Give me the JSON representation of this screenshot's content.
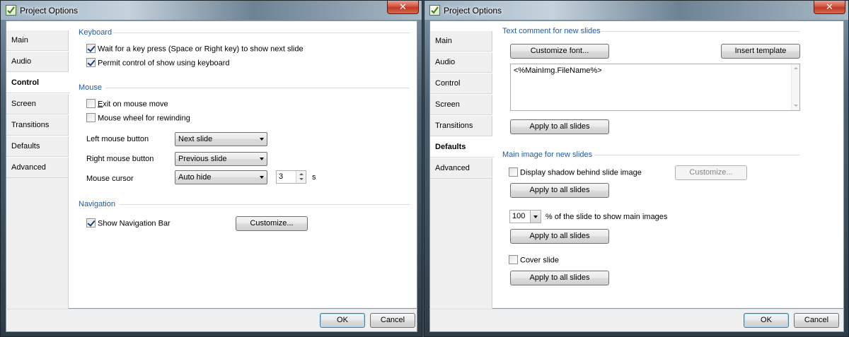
{
  "left": {
    "title": "Project Options",
    "close_glyph": "✕",
    "sidebar": {
      "items": [
        {
          "label": "Main"
        },
        {
          "label": "Audio"
        },
        {
          "label": "Control"
        },
        {
          "label": "Screen"
        },
        {
          "label": "Transitions"
        },
        {
          "label": "Defaults"
        },
        {
          "label": "Advanced"
        }
      ],
      "active": "Control"
    },
    "keyboard": {
      "heading": "Keyboard",
      "wait_key": {
        "label": "Wait for a key press (Space or Right key) to show next slide",
        "checked": true
      },
      "permit_control": {
        "label": "Permit control of show using keyboard",
        "checked": true
      }
    },
    "mouse": {
      "heading": "Mouse",
      "exit_on_move": {
        "label_first": "E",
        "label_rest": "xit on mouse move",
        "checked": false
      },
      "wheel_rewind": {
        "label": "Mouse wheel for rewinding",
        "checked": false
      },
      "left_button": {
        "label": "Left mouse button",
        "value": "Next slide"
      },
      "right_button": {
        "label": "Right mouse button",
        "value": "Previous slide"
      },
      "cursor": {
        "label": "Mouse cursor",
        "value": "Auto hide",
        "seconds": "3",
        "unit": "s"
      }
    },
    "navigation": {
      "heading": "Navigation",
      "show_bar": {
        "label": "Show Navigation Bar",
        "checked": true
      },
      "customize_label": "Customize..."
    },
    "footer": {
      "ok_label": "OK",
      "cancel_label": "Cancel"
    }
  },
  "right": {
    "title": "Project Options",
    "close_glyph": "✕",
    "sidebar": {
      "items": [
        {
          "label": "Main"
        },
        {
          "label": "Audio"
        },
        {
          "label": "Control"
        },
        {
          "label": "Screen"
        },
        {
          "label": "Transitions"
        },
        {
          "label": "Defaults"
        },
        {
          "label": "Advanced"
        }
      ],
      "active": "Defaults"
    },
    "text_comment": {
      "heading": "Text comment for new slides",
      "customize_font_label": "Customize font...",
      "insert_template_label": "Insert template",
      "text_value": "<%MainImg.FileName%>",
      "apply_label": "Apply to all slides"
    },
    "main_image": {
      "heading": "Main image for new slides",
      "shadow": {
        "label": "Display shadow behind slide image",
        "checked": false
      },
      "customize_label": "Customize...",
      "apply_label_1": "Apply to all slides",
      "percent_value": "100",
      "percent_label": "% of the slide to show main images",
      "apply_label_2": "Apply to all slides",
      "cover": {
        "label": "Cover slide",
        "checked": false
      },
      "apply_label_3": "Apply to all slides"
    },
    "footer": {
      "ok_label": "OK",
      "cancel_label": "Cancel"
    }
  },
  "colors": {
    "section_heading": "#1e5aa8",
    "close_button": "#c03a22",
    "default_button_border": "#3c7fb1"
  }
}
